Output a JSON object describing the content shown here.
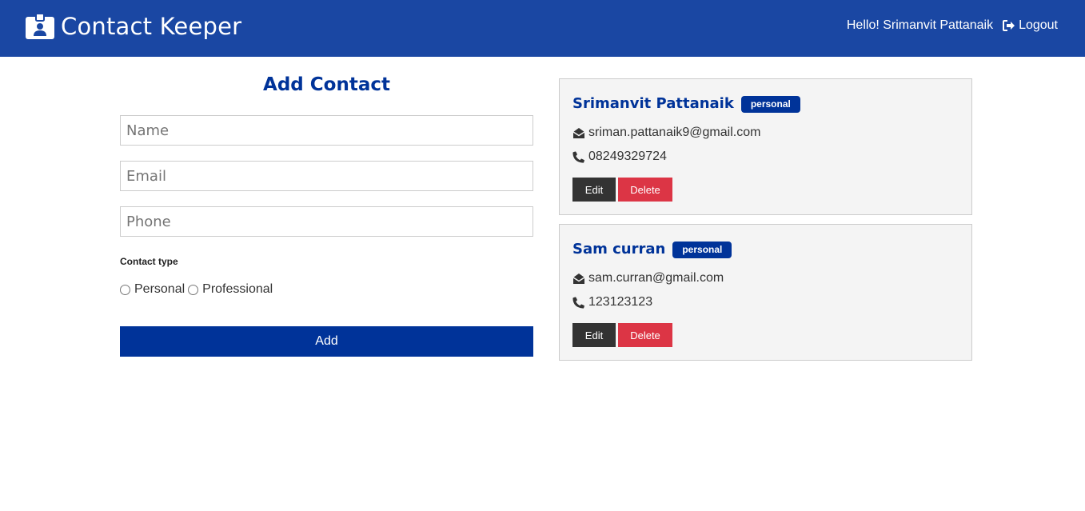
{
  "navbar": {
    "brand_icon": "id-badge-icon",
    "title": "Contact Keeper",
    "greeting": "Hello! Srimanvit Pattanaik",
    "logout_icon": "sign-out-icon",
    "logout_label": "Logout",
    "background": "#1a47a3"
  },
  "form": {
    "title": "Add Contact",
    "name_placeholder": "Name",
    "email_placeholder": "Email",
    "phone_placeholder": "Phone",
    "contact_type_label": "Contact type",
    "options": [
      "Personal",
      "Professional"
    ],
    "submit_label": "Add",
    "accent": "#003399"
  },
  "contacts": [
    {
      "name": "Srimanvit Pattanaik",
      "type": "personal",
      "email_icon": "envelope-open-icon",
      "email": "sriman.pattanaik9@gmail.com",
      "phone_icon": "phone-icon",
      "phone": "08249329724",
      "edit_label": "Edit",
      "delete_label": "Delete"
    },
    {
      "name": "Sam curran",
      "type": "personal",
      "email_icon": "envelope-open-icon",
      "email": "sam.curran@gmail.com",
      "phone_icon": "phone-icon",
      "phone": "123123123",
      "edit_label": "Edit",
      "delete_label": "Delete"
    }
  ],
  "colors": {
    "primary": "#003399",
    "danger": "#dc3545",
    "dark": "#333333",
    "card_bg": "#f4f4f4"
  }
}
